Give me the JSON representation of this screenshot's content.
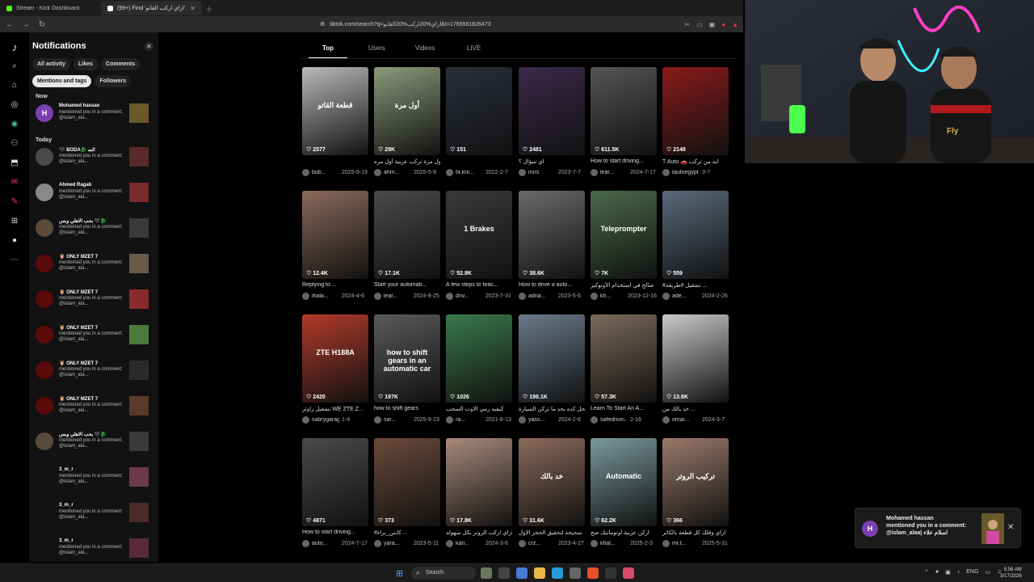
{
  "browser": {
    "tabs": [
      {
        "label": "Stream - Kick Dashboard",
        "active": false,
        "color": "#53fc18"
      },
      {
        "label": "(99+) Find 'ازاي اركب القاتو' on TikTok",
        "active": true,
        "color": "#ffffff"
      }
    ],
    "url": "tiktok.com/search?q=ازاي%20اركب%20القاتو&t=1769561826473"
  },
  "notifications": {
    "title": "Notifications",
    "filters": [
      "All activity",
      "Likes",
      "Comments"
    ],
    "filters2": [
      "Mentions and tags",
      "Followers"
    ],
    "section_now": "Now",
    "section_today": "Today",
    "items": [
      {
        "name": "Mohamed hassan",
        "text": "mentioned you in a comment: @islam_ala...",
        "avatar": "#7b3fb0",
        "initial": "H",
        "thumb": "#6a5a2a"
      },
      {
        "name": "🖤 BODA🐉 ﺍﻟﺴ",
        "text": "mentioned you in a comment: @islam_ala...",
        "avatar": "#4a4a4a",
        "initial": "",
        "thumb": "#5a2a2a"
      },
      {
        "name": "Ahmed Ragab",
        "text": "mentioned you in a comment: @islam_ala...",
        "avatar": "#8a8a8a",
        "initial": "",
        "thumb": "#7a2a2a"
      },
      {
        "name": "بحب الاهلي وبس 🖤🐉",
        "text": "mentioned you in a comment: @islam_ala...",
        "avatar": "#5a4a3a",
        "initial": "",
        "thumb": "#3a3a3a"
      },
      {
        "name": "🦉 ONLY MZET 7",
        "text": "mentioned you in a comment: @islam_ala...",
        "avatar": "#5a0a0a",
        "initial": "",
        "thumb": "#6a5a4a"
      },
      {
        "name": "🦉 ONLY MZET 7",
        "text": "mentioned you in a comment: @islam_ala...",
        "avatar": "#5a0a0a",
        "initial": "",
        "thumb": "#8a2a2a"
      },
      {
        "name": "🦉 ONLY MZET 7",
        "text": "mentioned you in a comment: @islam_ala...",
        "avatar": "#5a0a0a",
        "initial": "",
        "thumb": "#4a7a3a"
      },
      {
        "name": "🦉 ONLY MZET 7",
        "text": "mentioned you in a comment: @islam_ala...",
        "avatar": "#5a0a0a",
        "initial": "",
        "thumb": "#2a2a2a"
      },
      {
        "name": "🦉 ONLY MZET 7",
        "text": "mentioned you in a comment: @islam_ala...",
        "avatar": "#5a0a0a",
        "initial": "",
        "thumb": "#5a3a2a"
      },
      {
        "name": "بحب الاهلي وبس 🖤🐉",
        "text": "mentioned you in a comment: @islam_ala...",
        "avatar": "#5a4a3a",
        "initial": "",
        "thumb": "#3a3a3a"
      },
      {
        "name": "3_m_r",
        "text": "mentioned you in a comment: @islam_ala...",
        "avatar": "#111111",
        "initial": "",
        "thumb": "#6a3a4a"
      },
      {
        "name": "3_m_r",
        "text": "mentioned you in a comment: @islam_ala...",
        "avatar": "#111111",
        "initial": "",
        "thumb": "#4a2a2a"
      },
      {
        "name": "3_m_r",
        "text": "mentioned you in a comment: @islam_ala...",
        "avatar": "#111111",
        "initial": "",
        "thumb": "#5a2a3a"
      }
    ]
  },
  "search_tabs": [
    "Top",
    "Users",
    "Videos",
    "LIVE"
  ],
  "results": [
    {
      "count": "2577",
      "title": "",
      "author": "bob...",
      "date": "2025-9-19",
      "color": "#b9b9b9",
      "overlay": "قطعة القاتو"
    },
    {
      "count": "29K",
      "title": "أول مرة تركب عربية أول مره...",
      "author": "ahm...",
      "date": "2025-5-9",
      "color": "#8c9a7a",
      "overlay": "أول مرة"
    },
    {
      "count": "151",
      "title": "",
      "author": "fa.kni...",
      "date": "2022-2-7",
      "color": "#2a2f3a",
      "overlay": ""
    },
    {
      "count": "2481",
      "title": "اي سؤال ؟",
      "author": "irsrs",
      "date": "2023-7-7",
      "color": "#3a2a4a",
      "overlay": ""
    },
    {
      "count": "611.5K",
      "title": "How to start driving...",
      "author": "lear...",
      "date": "2024-7-17",
      "color": "#555555",
      "overlay": ""
    },
    {
      "count": "2148",
      "title": "T Auto 🚗 ايه من تركب",
      "author": "tautoegypt",
      "date": "3-7",
      "color": "#8a1a1a",
      "overlay": ""
    },
    {
      "count": "12.4K",
      "title": "Replying to ...",
      "author": "ihala...",
      "date": "2024-4-6",
      "color": "#8a6a5a",
      "overlay": ""
    },
    {
      "count": "17.1K",
      "title": "Start your automati...",
      "author": "lear...",
      "date": "2024-8-25",
      "color": "#4a4a4a",
      "overlay": ""
    },
    {
      "count": "52.8K",
      "title": "A few steps to teac...",
      "author": "driv...",
      "date": "2023-7-31",
      "color": "#3a3a3a",
      "overlay": "1 Brakes"
    },
    {
      "count": "38.6K",
      "title": "How to drive a auto...",
      "author": "adna...",
      "date": "2023-5-6",
      "color": "#6a6a6a",
      "overlay": ""
    },
    {
      "count": "7K",
      "title": "صالح في استخدام الأوتوكير",
      "author": "kh...",
      "date": "2023-12-16",
      "color": "#4a6a4a",
      "overlay": "Teleprompter"
    },
    {
      "count": "559",
      "title": "#تشغيل #طريقة ...",
      "author": "ade...",
      "date": "2024-2-26",
      "color": "#5a6a7a",
      "overlay": ""
    },
    {
      "count": "2420",
      "title": "تشغيل راوتر WE ZTE Z...",
      "author": "sabrygarage",
      "date": "1-4",
      "color": "#b23a2a",
      "overlay": "ZTE H188A"
    },
    {
      "count": "197K",
      "title": "how to shift gears",
      "author": "sar...",
      "date": "2025-9-23",
      "color": "#5a5a5a",
      "overlay": "how to shift gears in an automatic car"
    },
    {
      "count": "1026",
      "title": "كيفيه رمي الاوت السحب",
      "author": "ra...",
      "date": "2021-8-13",
      "color": "#3a7a4a",
      "overlay": ""
    },
    {
      "count": "198.1K",
      "title": "سحل كده بحد ما تركن السيارة",
      "author": "yass...",
      "date": "2024-2-6",
      "color": "#6a7a8a",
      "overlay": ""
    },
    {
      "count": "57.3K",
      "title": "Learn To Start An A...",
      "author": "safedrivin...",
      "date": "2-16",
      "color": "#7a6a5a",
      "overlay": ""
    },
    {
      "count": "13.6K",
      "title": "خد بالك من ...",
      "author": "omar...",
      "date": "2024-3-7",
      "color": "#c9c9c9",
      "overlay": ""
    },
    {
      "count": "4871",
      "title": "How to start driving...",
      "author": "auto...",
      "date": "2024-7-17",
      "color": "#4a4a4a",
      "overlay": ""
    },
    {
      "count": "373",
      "title": "#كابتن_براء ...",
      "author": "yara...",
      "date": "2023-5-11",
      "color": "#6a4a3a",
      "overlay": ""
    },
    {
      "count": "17.8K",
      "title": "ازاي اركب الروتر بكل سهوله",
      "author": "kari...",
      "date": "2024-3-6",
      "color": "#a88a7a",
      "overlay": ""
    },
    {
      "count": "31.6K",
      "title": "سحيحة لتحقيق الحجز الاول",
      "author": "crz...",
      "date": "2023-4-27",
      "color": "#8a6a5a",
      "overlay": "خد بالك"
    },
    {
      "count": "62.2K",
      "title": "اركن عربية أوتوماتيك صح",
      "author": "khal...",
      "date": "2025-2-3",
      "color": "#7a9a9a",
      "overlay": "Automatic"
    },
    {
      "count": "366",
      "title": "ازاي وقلك كل قطعة بالكاتر",
      "author": "mr.t...",
      "date": "2025-5-31",
      "color": "#9a7a6a",
      "overlay": "تركيب الروتر"
    }
  ],
  "toast": {
    "name": "Mohamed hassan",
    "text": "mentioned you in a comment: @islam_alaa| اسلام علاء",
    "initial": "H"
  },
  "taskbar": {
    "search": "Search",
    "lang": "ENG",
    "time": "5:56 AM",
    "date": "3/17/2026"
  }
}
